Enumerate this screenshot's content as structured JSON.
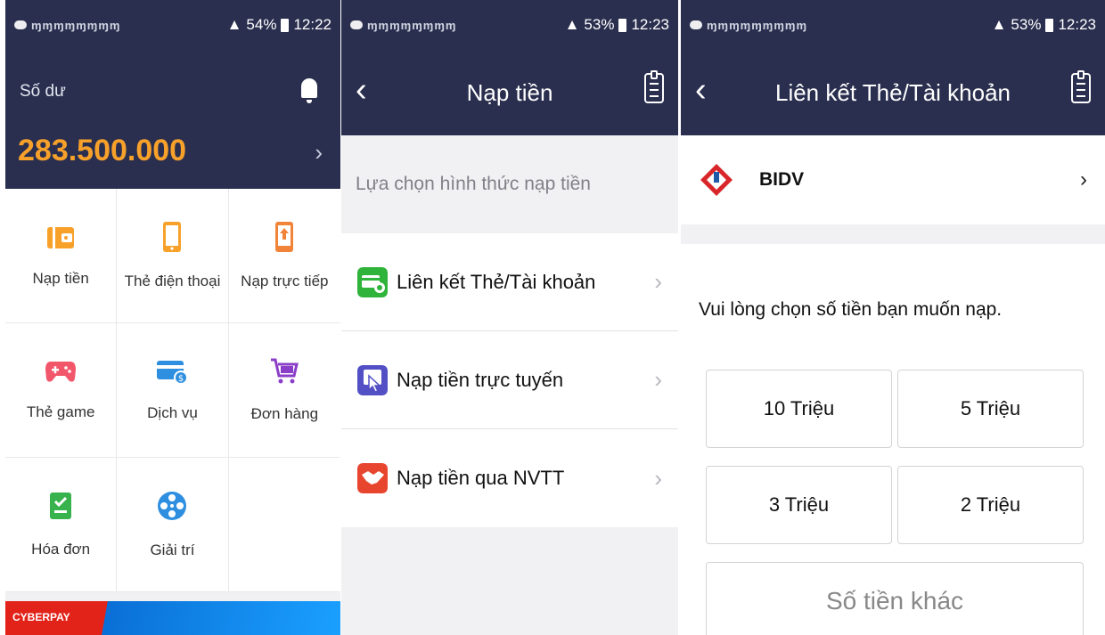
{
  "status_bars": [
    {
      "battery": "54%",
      "time": "12:22"
    },
    {
      "battery": "53%",
      "time": "12:23"
    },
    {
      "battery": "53%",
      "time": "12:23"
    }
  ],
  "home": {
    "balance_label": "Số dư",
    "balance": "283.500.000",
    "menu": [
      {
        "label": "Nạp tiền",
        "icon": "wallet-icon",
        "color": "#f7a12b"
      },
      {
        "label": "Thẻ điện thoại",
        "icon": "phone-icon",
        "color": "#f7a12b"
      },
      {
        "label": "Nạp trực tiếp",
        "icon": "phone-upload-icon",
        "color": "#f2843a"
      },
      {
        "label": "Thẻ game",
        "icon": "gamepad-icon",
        "color": "#f2566b"
      },
      {
        "label": "Dịch vụ",
        "icon": "card-icon",
        "color": "#2e8fe0"
      },
      {
        "label": "Đơn hàng",
        "icon": "cart-icon",
        "color": "#8b3fc8"
      },
      {
        "label": "Hóa đơn",
        "icon": "bill-icon",
        "color": "#37b24d"
      },
      {
        "label": "Giải trí",
        "icon": "film-reel-icon",
        "color": "#2e8fe0"
      }
    ],
    "banner_text": "CYBERPAY"
  },
  "topup": {
    "title": "Nạp tiền",
    "prompt": "Lựa chọn hình thức nạp tiền",
    "options": [
      {
        "label": "Liên kết Thẻ/Tài khoản",
        "icon": "linked-card-icon",
        "color": "#2fb33a"
      },
      {
        "label": "Nạp tiền trực tuyến",
        "icon": "online-topup-icon",
        "color": "#5250c4"
      },
      {
        "label": "Nạp tiền qua NVTT",
        "icon": "handshake-icon",
        "color": "#e8452e"
      }
    ]
  },
  "link_account": {
    "title": "Liên kết Thẻ/Tài khoản",
    "bank": "BIDV",
    "prompt": "Vui lòng chọn số tiền bạn muốn nạp.",
    "amounts": [
      "10 Triệu",
      "5 Triệu",
      "3 Triệu",
      "2 Triệu"
    ],
    "other_amount": "Số tiền khác"
  }
}
